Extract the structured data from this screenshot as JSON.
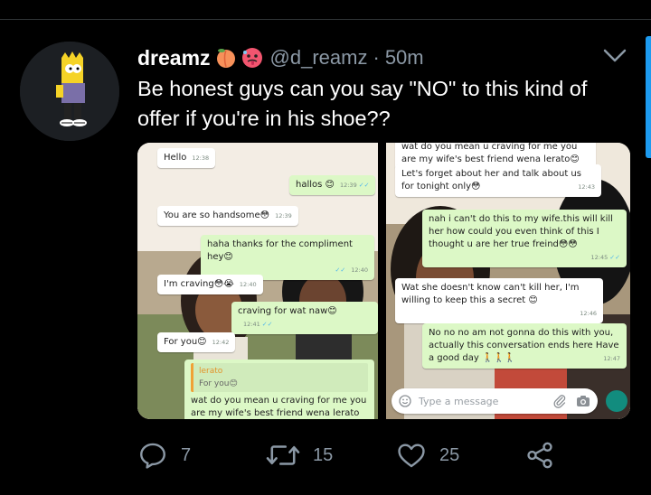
{
  "tweet": {
    "display_name": "dreamz",
    "name_emojis": [
      "peach-emoji",
      "hot-face-emoji"
    ],
    "handle": "@d_reamz",
    "separator": "·",
    "time": "50m",
    "text": "Be honest guys can you say \"NO\" to this kind of offer if you're in his shoe??"
  },
  "media": {
    "left_screenshot": {
      "messages": [
        {
          "side": "in",
          "text": "Hello",
          "time": "12:38"
        },
        {
          "side": "out",
          "text": "hallos 😊",
          "time": "12:39"
        },
        {
          "side": "in",
          "text": "You are so handsome😳",
          "time": "12:39"
        },
        {
          "side": "out",
          "text": "haha thanks for the compliment hey😊",
          "time": "12:40"
        },
        {
          "side": "in",
          "text": "I'm craving😳😭",
          "time": "12:40"
        },
        {
          "side": "out",
          "text": "craving for wat naw😊",
          "time": "12:41"
        },
        {
          "side": "in",
          "text": "For you😊",
          "time": "12:42"
        },
        {
          "side": "out",
          "quote_name": "lerato",
          "quote_text": "For you😊",
          "text": "wat do you mean u craving for me you are my wife's best friend wena lerato😳",
          "time": ""
        }
      ]
    },
    "right_screenshot": {
      "messages": [
        {
          "side": "in",
          "text": "wat do you mean u craving for me you are my wife's best friend wena lerato😊",
          "time": ""
        },
        {
          "side": "in",
          "text": "Let's forget about her and talk about us for tonight only😳",
          "time": "12:43"
        },
        {
          "side": "out",
          "text": "nah i can't do this to my wife.this will kill her how could you even think of this I thought u are her true freind😳😳",
          "time": "12:45"
        },
        {
          "side": "in",
          "text": "Wat she doesn't know can't kill her, I'm willing to keep this a secret 😊",
          "time": "12:46"
        },
        {
          "side": "out",
          "text": "No no no am not gonna do this with you, actually this conversation ends here Have a good day 🚶🚶🚶",
          "time": "12:47"
        }
      ],
      "composer_placeholder": "Type a message"
    }
  },
  "actions": {
    "replies": "7",
    "retweets": "15",
    "likes": "25"
  },
  "colors": {
    "background": "#000000",
    "secondary_text": "#8b98a5",
    "accent": "#1d9bf0",
    "bubble_out": "#dcf8c6",
    "bubble_in": "#ffffff"
  }
}
